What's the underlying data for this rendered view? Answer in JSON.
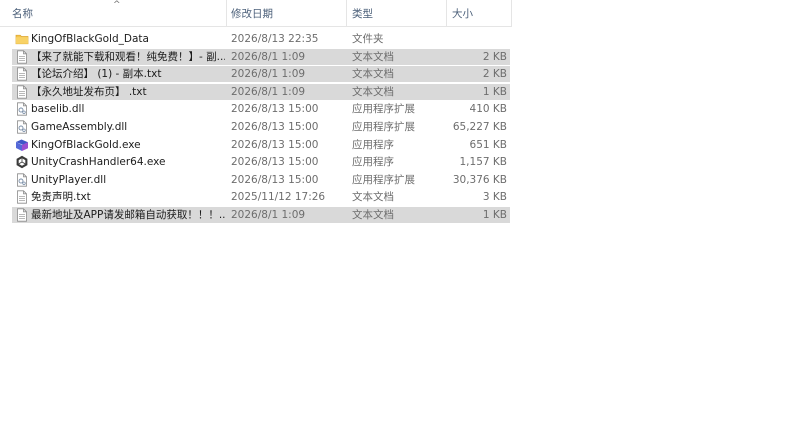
{
  "columns": {
    "name": "名称",
    "date": "修改日期",
    "type": "类型",
    "size": "大小"
  },
  "sort_indicator": "^",
  "rows": [
    {
      "name": "KingOfBlackGold_Data",
      "date": "2026/8/13 22:35",
      "type": "文件夹",
      "size": "",
      "icon": "folder-icon",
      "selected": false
    },
    {
      "name": "【来了就能下载和观看！纯免费！】- 副...",
      "date": "2026/8/1 1:09",
      "type": "文本文档",
      "size": "2 KB",
      "icon": "text-file-icon",
      "selected": true
    },
    {
      "name": "【论坛介绍】 (1) - 副本.txt",
      "date": "2026/8/1 1:09",
      "type": "文本文档",
      "size": "2 KB",
      "icon": "text-file-icon",
      "selected": true
    },
    {
      "name": "【永久地址发布页】 .txt",
      "date": "2026/8/1 1:09",
      "type": "文本文档",
      "size": "1 KB",
      "icon": "text-file-icon",
      "selected": true
    },
    {
      "name": "baselib.dll",
      "date": "2026/8/13 15:00",
      "type": "应用程序扩展",
      "size": "410 KB",
      "icon": "dll-file-icon",
      "selected": false
    },
    {
      "name": "GameAssembly.dll",
      "date": "2026/8/13 15:00",
      "type": "应用程序扩展",
      "size": "65,227 KB",
      "icon": "dll-file-icon",
      "selected": false
    },
    {
      "name": "KingOfBlackGold.exe",
      "date": "2026/8/13 15:00",
      "type": "应用程序",
      "size": "651 KB",
      "icon": "game-exe-icon",
      "selected": false
    },
    {
      "name": "UnityCrashHandler64.exe",
      "date": "2026/8/13 15:00",
      "type": "应用程序",
      "size": "1,157 KB",
      "icon": "unity-exe-icon",
      "selected": false
    },
    {
      "name": "UnityPlayer.dll",
      "date": "2026/8/13 15:00",
      "type": "应用程序扩展",
      "size": "30,376 KB",
      "icon": "dll-file-icon",
      "selected": false
    },
    {
      "name": "免责声明.txt",
      "date": "2025/11/12 17:26",
      "type": "文本文档",
      "size": "3 KB",
      "icon": "text-file-icon",
      "selected": false
    },
    {
      "name": "最新地址及APP请发邮箱自动获取！！！...",
      "date": "2026/8/1 1:09",
      "type": "文本文档",
      "size": "1 KB",
      "icon": "text-file-icon",
      "selected": true
    }
  ]
}
